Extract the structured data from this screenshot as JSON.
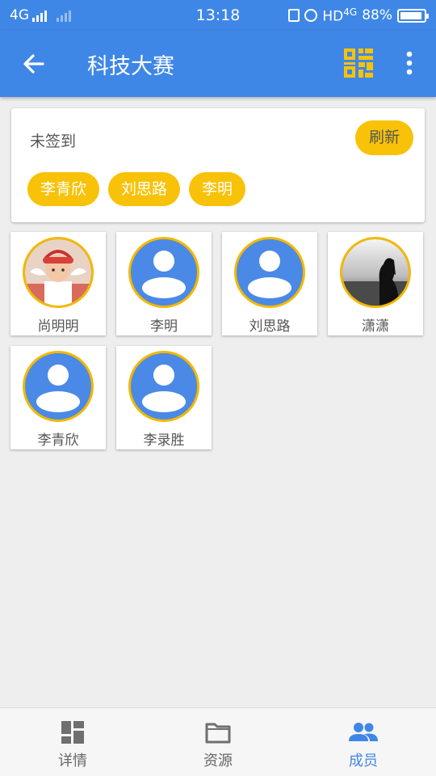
{
  "status_bar": {
    "network_left": "4G",
    "time": "13:18",
    "network_right": "HD",
    "network_right_sup": "4G",
    "battery": "88%"
  },
  "app_bar": {
    "title": "科技大赛",
    "icons": [
      "back-arrow-icon",
      "qr-code-icon",
      "more-vert-icon"
    ]
  },
  "unsigned_card": {
    "label": "未签到",
    "refresh_label": "刷新",
    "names": [
      "李青欣",
      "刘思路",
      "李明"
    ]
  },
  "members": [
    {
      "name": "尚明明",
      "avatar": "photo-child"
    },
    {
      "name": "李明",
      "avatar": "default-person"
    },
    {
      "name": "刘思路",
      "avatar": "default-person"
    },
    {
      "name": "潇潇",
      "avatar": "photo-silhouette"
    },
    {
      "name": "李青欣",
      "avatar": "default-person"
    },
    {
      "name": "李录胜",
      "avatar": "default-person"
    }
  ],
  "bottom_nav": {
    "tabs": [
      {
        "label": "详情",
        "icon": "dashboard-icon"
      },
      {
        "label": "资源",
        "icon": "folder-icon"
      },
      {
        "label": "成员",
        "icon": "people-icon",
        "active": true
      }
    ]
  },
  "colors": {
    "primary": "#3f87e6",
    "accent": "#f8c208",
    "avatar_ring": "#f4b800"
  }
}
